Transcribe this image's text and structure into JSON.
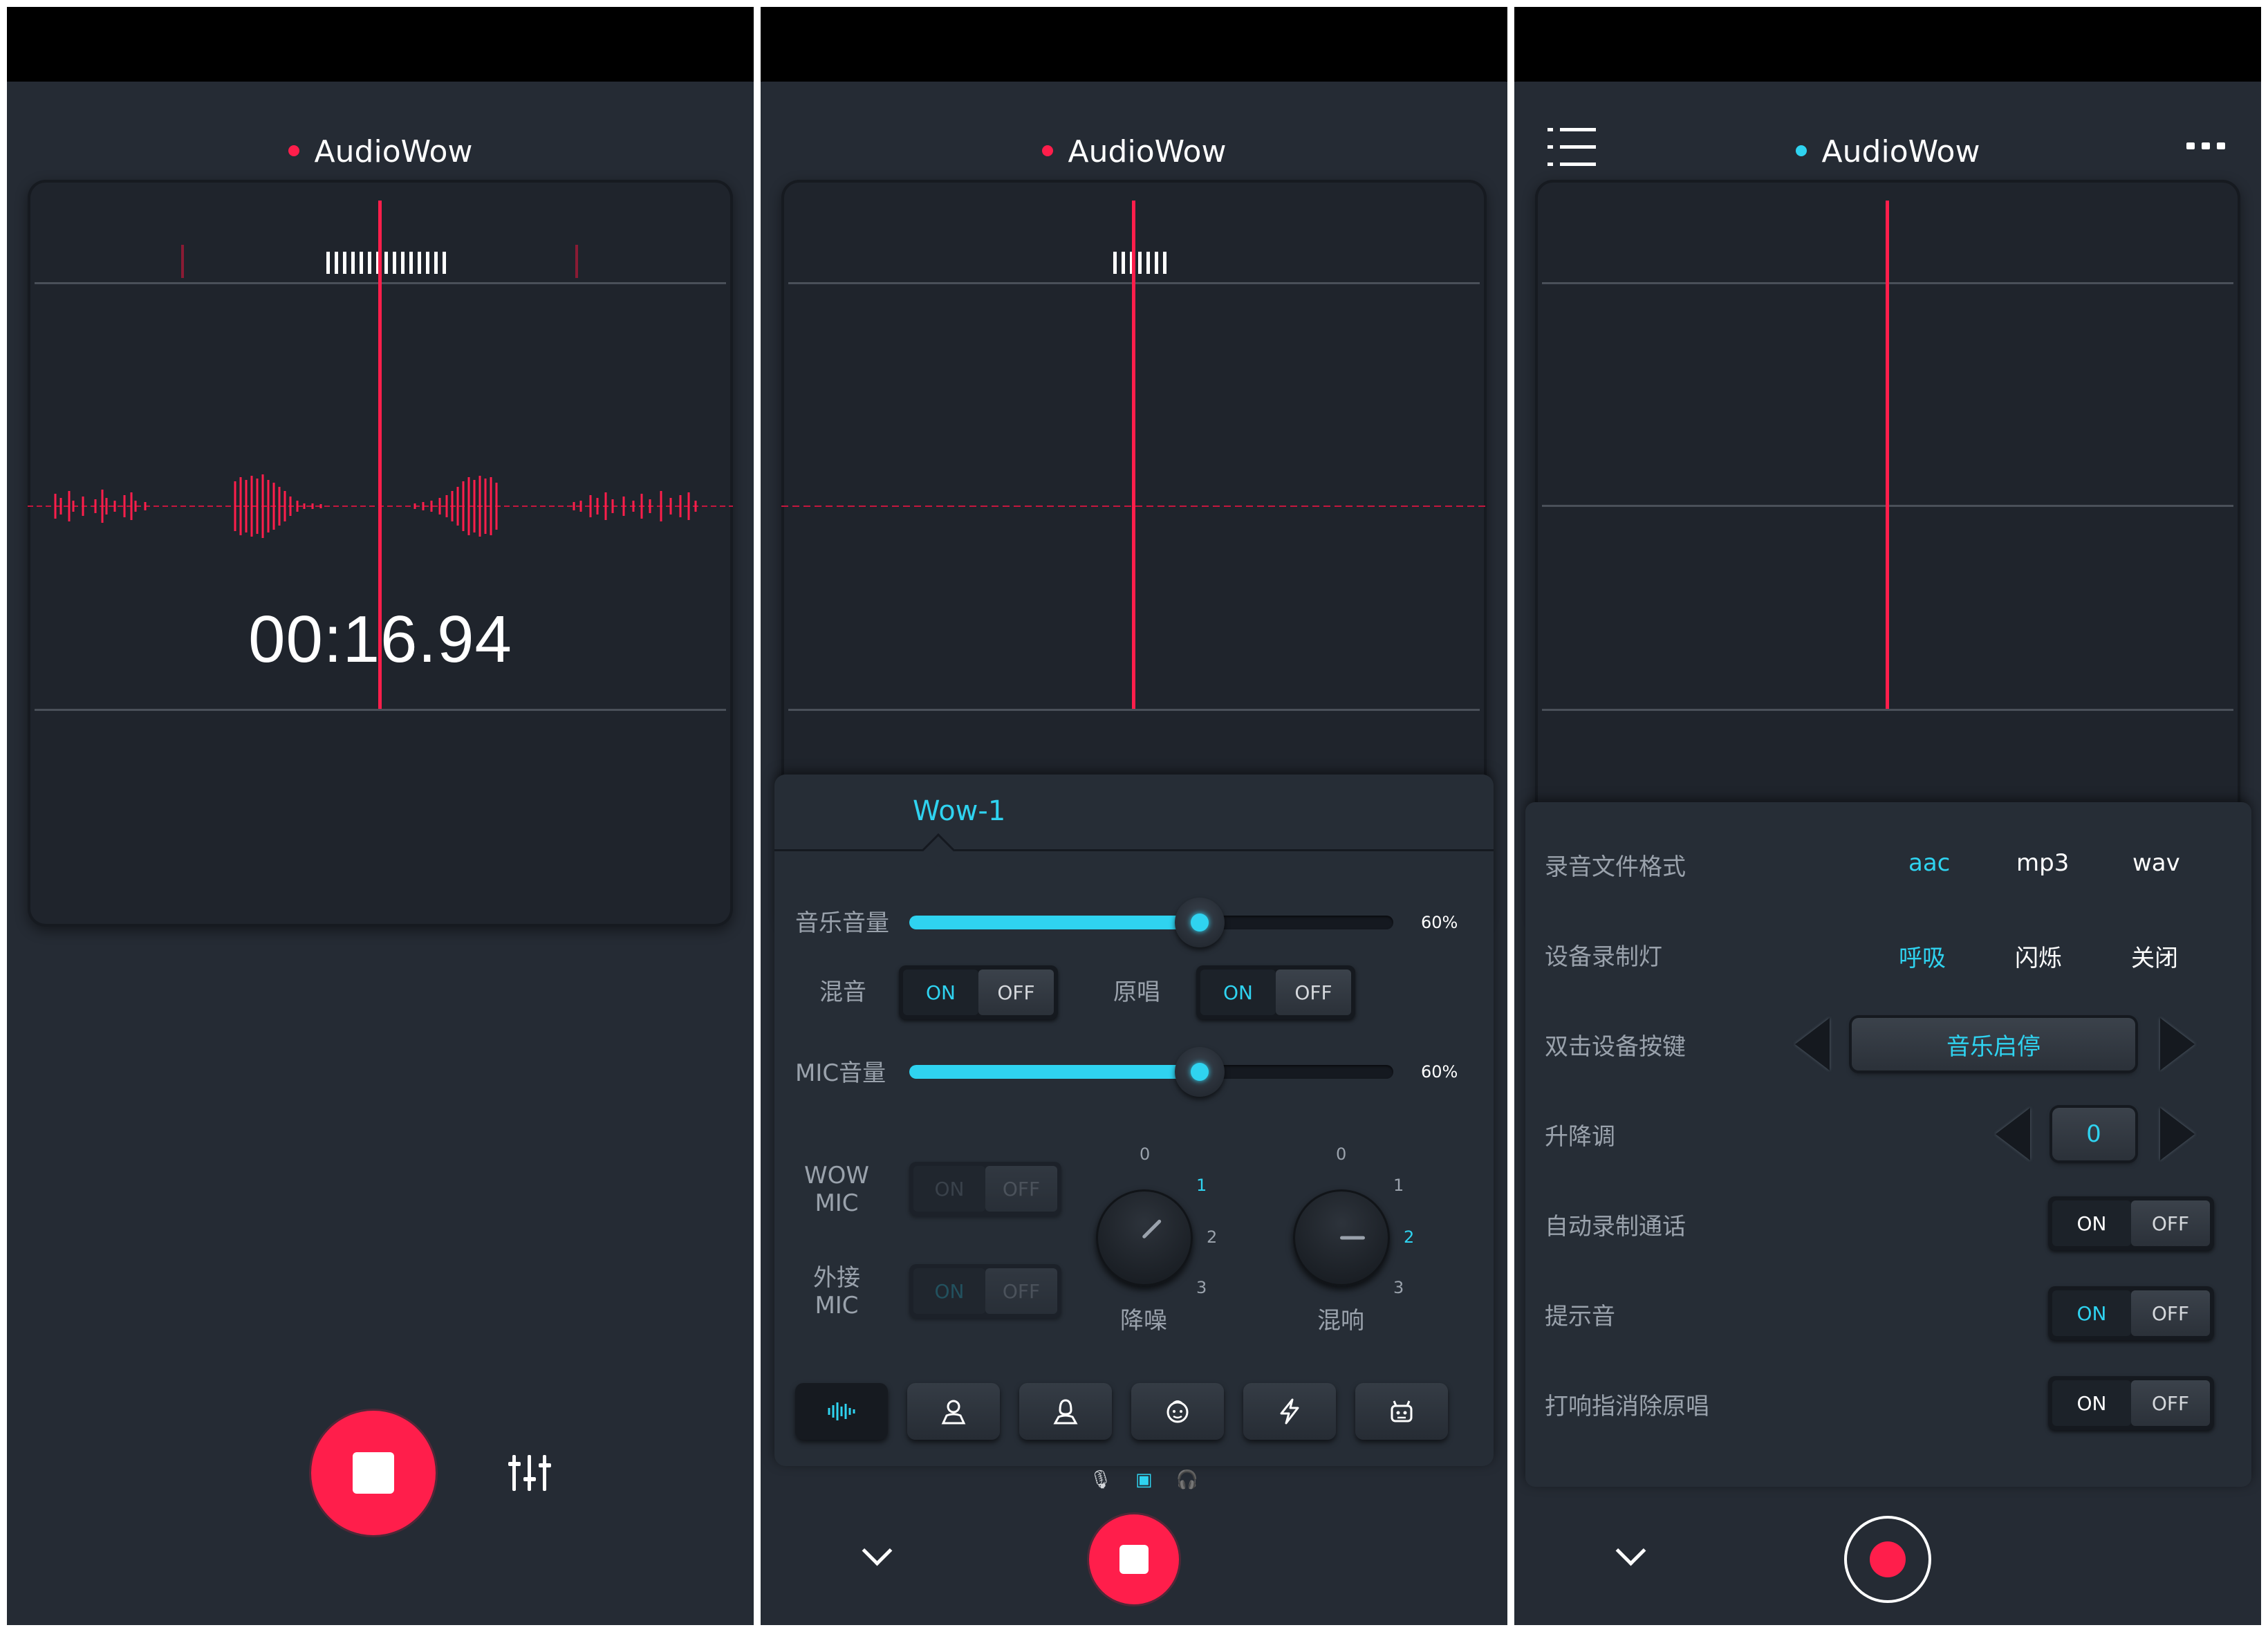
{
  "app_title": "AudioWow",
  "panel1": {
    "timer": "00:16.94"
  },
  "panel2": {
    "tab": "Wow-1",
    "music_volume_label": "音乐音量",
    "music_volume_pct": "60%",
    "music_volume_value": 0.6,
    "mix_label": "混音",
    "original_label": "原唱",
    "mic_volume_label": "MIC音量",
    "mic_volume_pct": "60%",
    "mic_volume_value": 0.6,
    "wow_mic_label_1": "WOW",
    "wow_mic_label_2": "MIC",
    "ext_mic_label_1": "外接",
    "ext_mic_label_2": "MIC",
    "toggle_on": "ON",
    "toggle_off": "OFF",
    "noise_label": "降噪",
    "reverb_label": "混响",
    "dial_ticks": [
      "0",
      "1",
      "2",
      "3"
    ],
    "noise_dial_level": 1,
    "reverb_dial_level": 2,
    "modes": [
      "waveform-icon",
      "person-icon",
      "person-alt-icon",
      "child-face-icon",
      "lightning-icon",
      "robot-icon"
    ]
  },
  "panel3": {
    "format_label": "录音文件格式",
    "format_options": [
      "aac",
      "mp3",
      "wav"
    ],
    "light_label": "设备录制灯",
    "light_options": [
      "呼吸",
      "闪烁",
      "关闭"
    ],
    "double_click_label": "双击设备按键",
    "double_click_value": "音乐启停",
    "pitch_label": "升降调",
    "pitch_value": "0",
    "auto_record_label": "自动录制通话",
    "prompt_tone_label": "提示音",
    "cancel_vocal_label": "打响指消除原唱",
    "toggle_on": "ON",
    "toggle_off": "OFF"
  },
  "colors": {
    "accent": "#2fd3f0",
    "record": "#ff1e4b",
    "background": "#252b34"
  }
}
